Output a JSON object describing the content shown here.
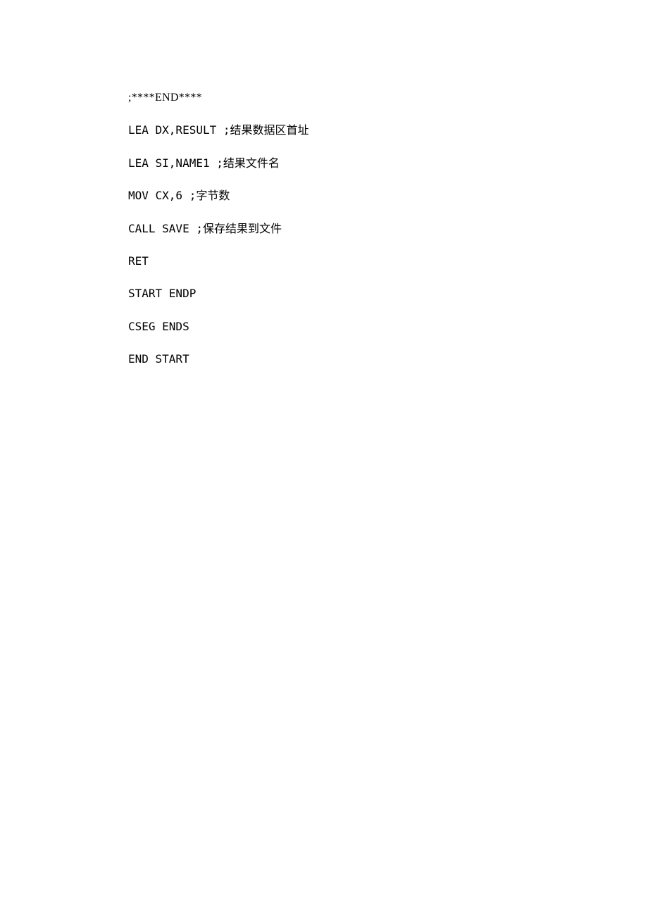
{
  "lines": [
    ";****END****",
    "LEA DX,RESULT ;结果数据区首址",
    "LEA SI,NAME1 ;结果文件名",
    "MOV CX,6 ;字节数",
    "CALL SAVE ;保存结果到文件",
    "RET",
    "START ENDP",
    "CSEG ENDS",
    "END START"
  ]
}
